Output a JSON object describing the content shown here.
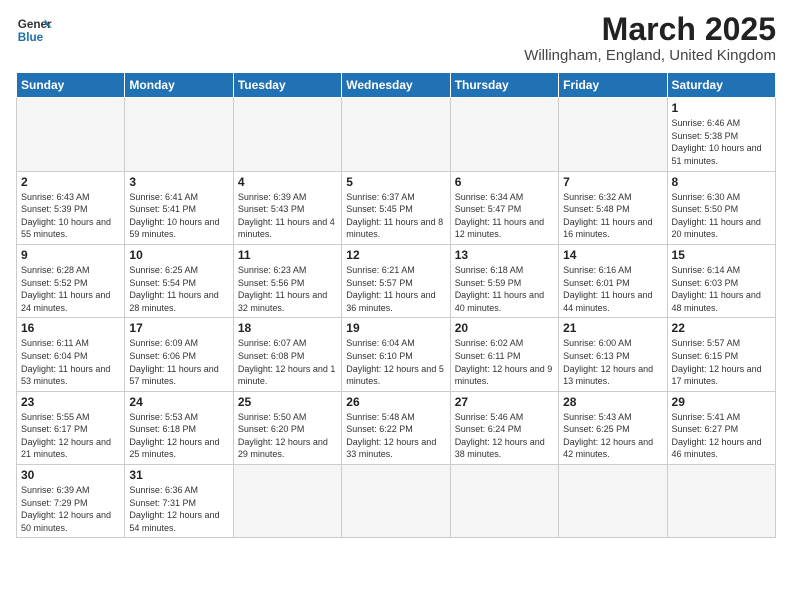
{
  "header": {
    "logo_general": "General",
    "logo_blue": "Blue",
    "month_year": "March 2025",
    "location": "Willingham, England, United Kingdom"
  },
  "days_of_week": [
    "Sunday",
    "Monday",
    "Tuesday",
    "Wednesday",
    "Thursday",
    "Friday",
    "Saturday"
  ],
  "weeks": [
    [
      {
        "day": "",
        "info": ""
      },
      {
        "day": "",
        "info": ""
      },
      {
        "day": "",
        "info": ""
      },
      {
        "day": "",
        "info": ""
      },
      {
        "day": "",
        "info": ""
      },
      {
        "day": "",
        "info": ""
      },
      {
        "day": "1",
        "info": "Sunrise: 6:46 AM\nSunset: 5:38 PM\nDaylight: 10 hours and 51 minutes."
      }
    ],
    [
      {
        "day": "2",
        "info": "Sunrise: 6:43 AM\nSunset: 5:39 PM\nDaylight: 10 hours and 55 minutes."
      },
      {
        "day": "3",
        "info": "Sunrise: 6:41 AM\nSunset: 5:41 PM\nDaylight: 10 hours and 59 minutes."
      },
      {
        "day": "4",
        "info": "Sunrise: 6:39 AM\nSunset: 5:43 PM\nDaylight: 11 hours and 4 minutes."
      },
      {
        "day": "5",
        "info": "Sunrise: 6:37 AM\nSunset: 5:45 PM\nDaylight: 11 hours and 8 minutes."
      },
      {
        "day": "6",
        "info": "Sunrise: 6:34 AM\nSunset: 5:47 PM\nDaylight: 11 hours and 12 minutes."
      },
      {
        "day": "7",
        "info": "Sunrise: 6:32 AM\nSunset: 5:48 PM\nDaylight: 11 hours and 16 minutes."
      },
      {
        "day": "8",
        "info": "Sunrise: 6:30 AM\nSunset: 5:50 PM\nDaylight: 11 hours and 20 minutes."
      }
    ],
    [
      {
        "day": "9",
        "info": "Sunrise: 6:28 AM\nSunset: 5:52 PM\nDaylight: 11 hours and 24 minutes."
      },
      {
        "day": "10",
        "info": "Sunrise: 6:25 AM\nSunset: 5:54 PM\nDaylight: 11 hours and 28 minutes."
      },
      {
        "day": "11",
        "info": "Sunrise: 6:23 AM\nSunset: 5:56 PM\nDaylight: 11 hours and 32 minutes."
      },
      {
        "day": "12",
        "info": "Sunrise: 6:21 AM\nSunset: 5:57 PM\nDaylight: 11 hours and 36 minutes."
      },
      {
        "day": "13",
        "info": "Sunrise: 6:18 AM\nSunset: 5:59 PM\nDaylight: 11 hours and 40 minutes."
      },
      {
        "day": "14",
        "info": "Sunrise: 6:16 AM\nSunset: 6:01 PM\nDaylight: 11 hours and 44 minutes."
      },
      {
        "day": "15",
        "info": "Sunrise: 6:14 AM\nSunset: 6:03 PM\nDaylight: 11 hours and 48 minutes."
      }
    ],
    [
      {
        "day": "16",
        "info": "Sunrise: 6:11 AM\nSunset: 6:04 PM\nDaylight: 11 hours and 53 minutes."
      },
      {
        "day": "17",
        "info": "Sunrise: 6:09 AM\nSunset: 6:06 PM\nDaylight: 11 hours and 57 minutes."
      },
      {
        "day": "18",
        "info": "Sunrise: 6:07 AM\nSunset: 6:08 PM\nDaylight: 12 hours and 1 minute."
      },
      {
        "day": "19",
        "info": "Sunrise: 6:04 AM\nSunset: 6:10 PM\nDaylight: 12 hours and 5 minutes."
      },
      {
        "day": "20",
        "info": "Sunrise: 6:02 AM\nSunset: 6:11 PM\nDaylight: 12 hours and 9 minutes."
      },
      {
        "day": "21",
        "info": "Sunrise: 6:00 AM\nSunset: 6:13 PM\nDaylight: 12 hours and 13 minutes."
      },
      {
        "day": "22",
        "info": "Sunrise: 5:57 AM\nSunset: 6:15 PM\nDaylight: 12 hours and 17 minutes."
      }
    ],
    [
      {
        "day": "23",
        "info": "Sunrise: 5:55 AM\nSunset: 6:17 PM\nDaylight: 12 hours and 21 minutes."
      },
      {
        "day": "24",
        "info": "Sunrise: 5:53 AM\nSunset: 6:18 PM\nDaylight: 12 hours and 25 minutes."
      },
      {
        "day": "25",
        "info": "Sunrise: 5:50 AM\nSunset: 6:20 PM\nDaylight: 12 hours and 29 minutes."
      },
      {
        "day": "26",
        "info": "Sunrise: 5:48 AM\nSunset: 6:22 PM\nDaylight: 12 hours and 33 minutes."
      },
      {
        "day": "27",
        "info": "Sunrise: 5:46 AM\nSunset: 6:24 PM\nDaylight: 12 hours and 38 minutes."
      },
      {
        "day": "28",
        "info": "Sunrise: 5:43 AM\nSunset: 6:25 PM\nDaylight: 12 hours and 42 minutes."
      },
      {
        "day": "29",
        "info": "Sunrise: 5:41 AM\nSunset: 6:27 PM\nDaylight: 12 hours and 46 minutes."
      }
    ],
    [
      {
        "day": "30",
        "info": "Sunrise: 6:39 AM\nSunset: 7:29 PM\nDaylight: 12 hours and 50 minutes."
      },
      {
        "day": "31",
        "info": "Sunrise: 6:36 AM\nSunset: 7:31 PM\nDaylight: 12 hours and 54 minutes."
      },
      {
        "day": "",
        "info": ""
      },
      {
        "day": "",
        "info": ""
      },
      {
        "day": "",
        "info": ""
      },
      {
        "day": "",
        "info": ""
      },
      {
        "day": "",
        "info": ""
      }
    ]
  ]
}
